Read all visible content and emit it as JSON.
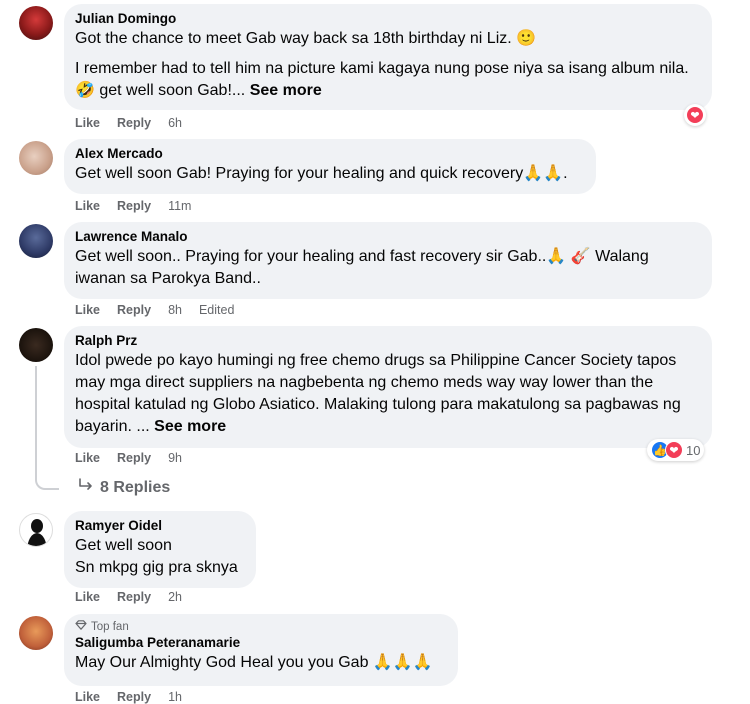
{
  "labels": {
    "like": "Like",
    "reply": "Reply"
  },
  "comments": [
    {
      "name": "Julian Domingo",
      "paragraphs": [
        "Got the chance to meet Gab way back sa 18th birthday ni Liz. 🙂",
        "I remember had to tell him na picture kami kagaya nung pose niya sa isang album nila. 🤣 get well soon Gab!..."
      ],
      "see_more": "See more",
      "time": "6h",
      "reaction": "heart"
    },
    {
      "name": "Alex Mercado",
      "paragraphs": [
        "Get well soon Gab! Praying for your healing and quick recovery🙏🙏."
      ],
      "time": "11m"
    },
    {
      "name": "Lawrence Manalo",
      "paragraphs": [
        "Get well soon.. Praying for your healing and fast recovery sir Gab..🙏 🎸 Walang iwanan sa Parokya Band.."
      ],
      "time": "8h",
      "edited": "Edited"
    },
    {
      "name": "Ralph Prz",
      "paragraphs": [
        "Idol pwede po kayo humingi ng free chemo drugs sa Philippine Cancer Society tapos may mga direct suppliers na nagbebenta ng chemo meds way way lower than the hospital katulad ng Globo Asiatico. Malaking tulong para makatulong sa pagbawas ng bayarin. ..."
      ],
      "see_more": "See more",
      "time": "9h",
      "reaction_count": "10",
      "replies": "8 Replies"
    },
    {
      "name": "Ramyer Oidel",
      "paragraphs": [
        "Get well soon",
        "Sn mkpg gig pra sknya"
      ],
      "time": "2h"
    },
    {
      "name": "Saligumba Peteranamarie",
      "badge": "Top fan",
      "paragraphs": [
        "May Our Almighty God Heal you you Gab 🙏🙏🙏"
      ],
      "time": "1h"
    }
  ],
  "colors": {
    "bubble": "#f0f2f5",
    "meta": "#65676b",
    "like_blue": "#1877f2",
    "love_red": "#f33e58"
  }
}
